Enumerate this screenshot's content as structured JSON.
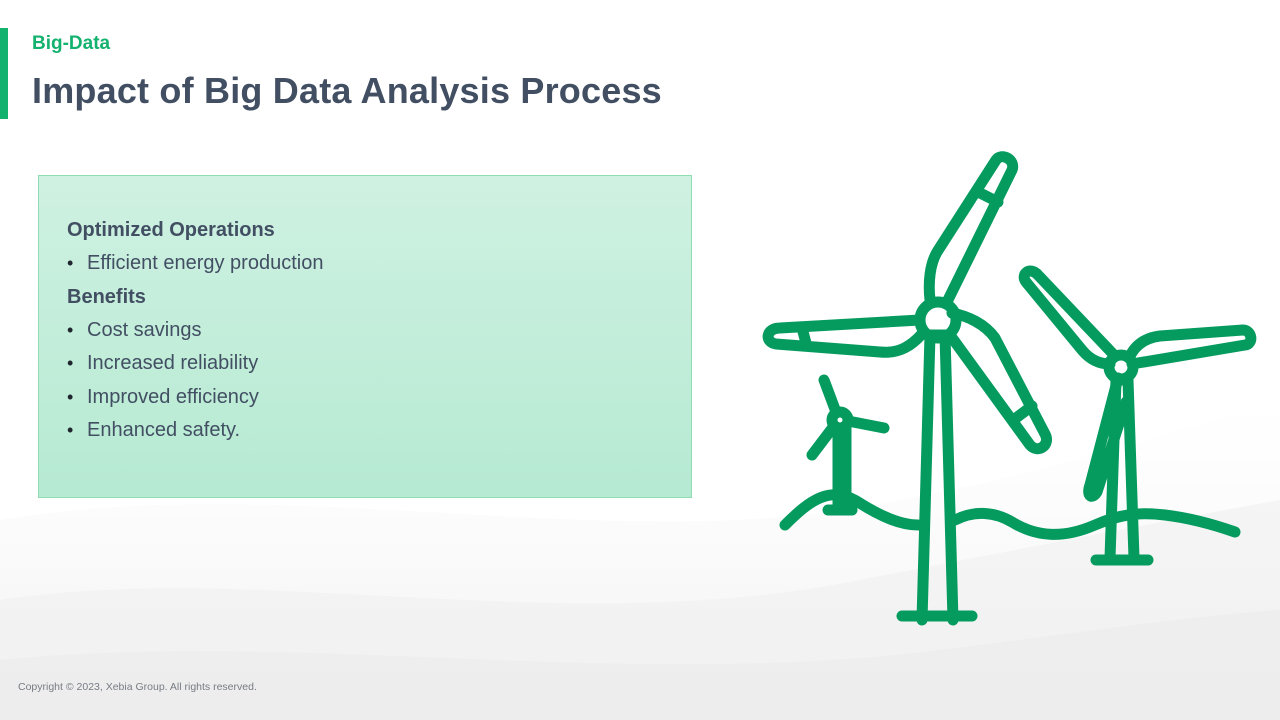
{
  "header": {
    "section_label": "Big-Data",
    "title": "Impact of Big Data Analysis Process"
  },
  "content": {
    "sections": [
      {
        "heading": "Optimized Operations",
        "items": [
          "Efficient energy production"
        ]
      },
      {
        "heading": "Benefits",
        "items": [
          "Cost savings",
          "Increased reliability",
          "Improved efficiency",
          "Enhanced safety."
        ]
      }
    ]
  },
  "illustration": {
    "icon": "wind-turbines-icon",
    "color": "#059b5f"
  },
  "footer": {
    "copyright": "Copyright © 2023, Xebia Group. All rights reserved."
  },
  "colors": {
    "accent": "#14b26f",
    "title": "#424f63",
    "box_border": "#8fdcb3",
    "box_fill_top": "#cff1e2",
    "box_fill_bottom": "#b6ead2"
  }
}
